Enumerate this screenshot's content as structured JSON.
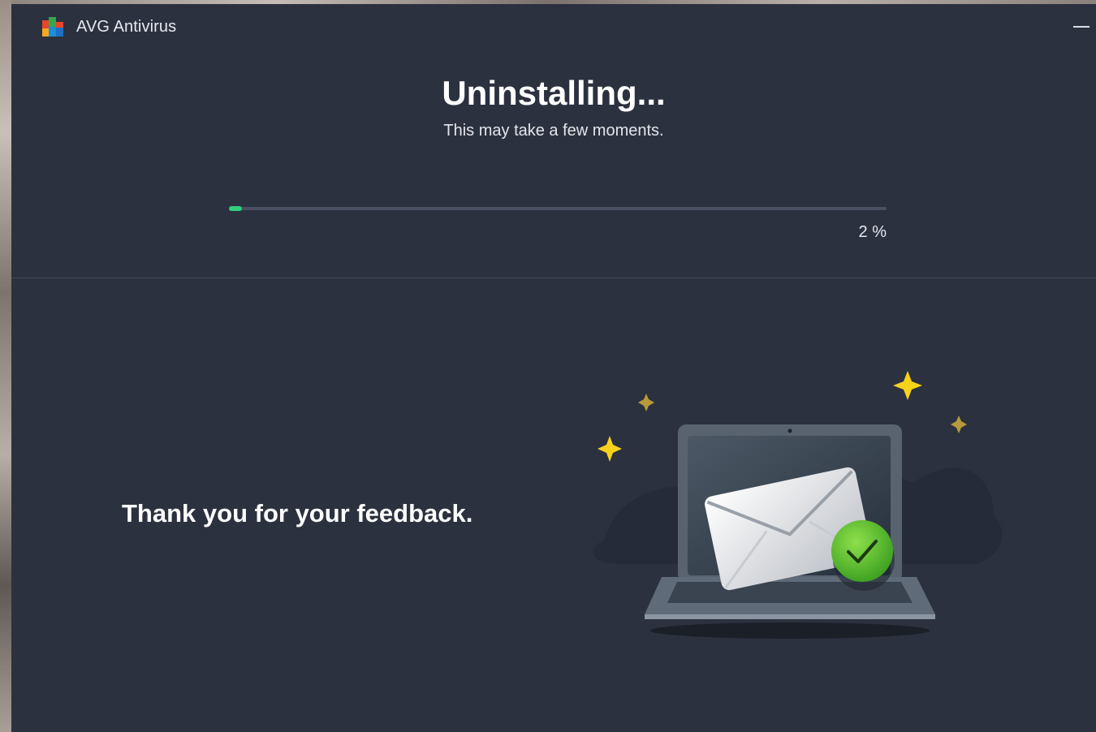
{
  "window": {
    "title": "AVG Antivirus"
  },
  "titlebar": {
    "logo_icon": "avg-logo-icon",
    "minimize_icon": "minimize-icon"
  },
  "main": {
    "heading": "Uninstalling...",
    "subheading": "This may take a few moments.",
    "progress": {
      "value_percent": 2,
      "label": "2 %"
    }
  },
  "feedback": {
    "message": "Thank you for your feedback.",
    "illustration_icon": "laptop-envelope-check-icon"
  },
  "colors": {
    "window_background": "#2c3140",
    "progress_fill": "#2fcf7a",
    "progress_track": "#4a5061",
    "sparkle": "#f7d21a",
    "check_badge": "#4dbb2b"
  }
}
